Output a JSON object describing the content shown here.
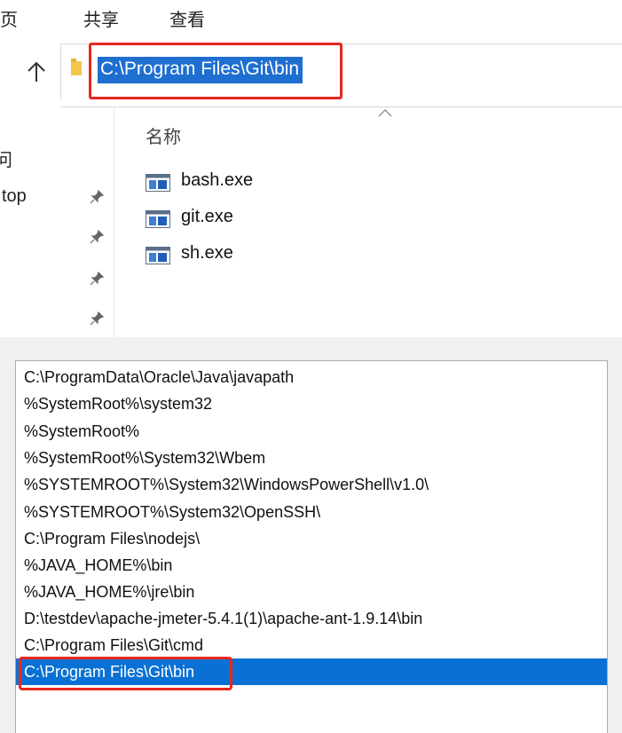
{
  "ribbon": {
    "tabs": [
      "主页",
      "共享",
      "查看"
    ],
    "tab_first_visible": "页"
  },
  "address_bar": {
    "up_icon": "up-arrow-icon",
    "folder_icon": "folder-icon",
    "path": "C:\\Program Files\\Git\\bin",
    "highlight_color": "#e8271d",
    "selection_color": "#1f6fd0"
  },
  "nav_pane": {
    "items": [
      {
        "label": "问",
        "pinned": false
      },
      {
        "label": "top",
        "pinned": true
      },
      {
        "label": "",
        "pinned": true
      },
      {
        "label": "",
        "pinned": true
      },
      {
        "label": "",
        "pinned": true
      }
    ],
    "pin_icon": "pin-icon"
  },
  "file_list": {
    "column_header": "名称",
    "sort_icon": "sort-ascending-caret-icon",
    "files": [
      {
        "name": "bash.exe",
        "icon": "exe-file-icon"
      },
      {
        "name": "git.exe",
        "icon": "exe-file-icon"
      },
      {
        "name": "sh.exe",
        "icon": "exe-file-icon"
      }
    ]
  },
  "path_dialog": {
    "entries": [
      "C:\\ProgramData\\Oracle\\Java\\javapath",
      "%SystemRoot%\\system32",
      "%SystemRoot%",
      "%SystemRoot%\\System32\\Wbem",
      "%SYSTEMROOT%\\System32\\WindowsPowerShell\\v1.0\\",
      "%SYSTEMROOT%\\System32\\OpenSSH\\",
      "C:\\Program Files\\nodejs\\",
      "%JAVA_HOME%\\bin",
      "%JAVA_HOME%\\jre\\bin",
      "D:\\testdev\\apache-jmeter-5.4.1(1)\\apache-ant-1.9.14\\bin",
      "C:\\Program Files\\Git\\cmd",
      "C:\\Program Files\\Git\\bin"
    ],
    "selected_index": 11,
    "selected_color": "#0a71d4"
  }
}
